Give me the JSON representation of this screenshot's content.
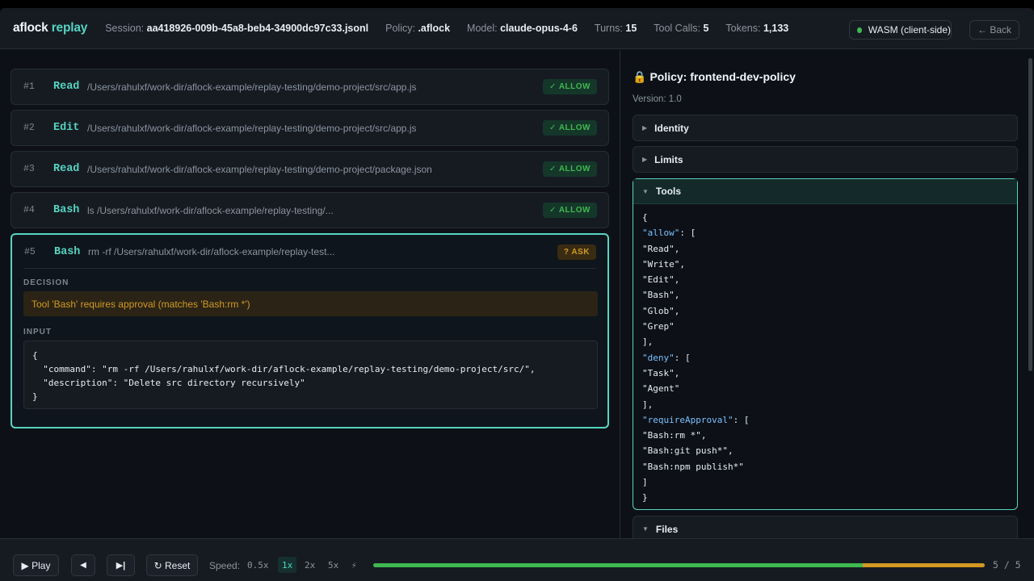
{
  "header": {
    "brand_main": "aflock",
    "brand_accent": "replay",
    "session_label": "Session:",
    "session_value": "aa418926-009b-45a8-beb4-34900dc97c33.jsonl",
    "policy_label": "Policy:",
    "policy_value": ".aflock",
    "model_label": "Model:",
    "model_value": "claude-opus-4-6",
    "turns_label": "Turns:",
    "turns_value": "15",
    "toolcalls_label": "Tool Calls:",
    "toolcalls_value": "5",
    "tokens_label": "Tokens:",
    "tokens_value": "1,133",
    "wasm_label": "WASM (client-side)",
    "back_label": "← Back"
  },
  "turns": [
    {
      "num": "#1",
      "tool": "Read",
      "path": "/Users/rahulxf/work-dir/aflock-example/replay-testing/demo-project/src/app.js",
      "badge": "✓ ALLOW"
    },
    {
      "num": "#2",
      "tool": "Edit",
      "path": "/Users/rahulxf/work-dir/aflock-example/replay-testing/demo-project/src/app.js",
      "badge": "✓ ALLOW"
    },
    {
      "num": "#3",
      "tool": "Read",
      "path": "/Users/rahulxf/work-dir/aflock-example/replay-testing/demo-project/package.json",
      "badge": "✓ ALLOW"
    },
    {
      "num": "#4",
      "tool": "Bash",
      "path": "ls /Users/rahulxf/work-dir/aflock-example/replay-testing/...",
      "badge": "✓ ALLOW"
    },
    {
      "num": "#5",
      "tool": "Bash",
      "path": "rm -rf /Users/rahulxf/work-dir/aflock-example/replay-test...",
      "badge": "? ASK"
    }
  ],
  "detail": {
    "decision_label": "DECISION",
    "decision_text": "Tool 'Bash' requires approval (matches 'Bash:rm *')",
    "input_label": "INPUT",
    "input_json": "{\n  \"command\": \"rm -rf /Users/rahulxf/work-dir/aflock-example/replay-testing/demo-project/src/\",\n  \"description\": \"Delete src directory recursively\"\n}"
  },
  "policy": {
    "lock_icon": "🔒",
    "title": "Policy: frontend-dev-policy",
    "version": "Version: 1.0",
    "sections": [
      {
        "label": "Identity",
        "caret": "▶"
      },
      {
        "label": "Limits",
        "caret": "▶"
      },
      {
        "label": "Tools",
        "caret": "▼"
      },
      {
        "label": "Files",
        "caret": "▼"
      }
    ],
    "tools_keys": {
      "allow": "\"allow\"",
      "deny": "\"deny\"",
      "requireApproval": "\"requireApproval\""
    },
    "tools_allow": [
      "Read",
      "Write",
      "Edit",
      "Bash",
      "Glob",
      "Grep"
    ],
    "tools_deny": [
      "Task",
      "Agent"
    ],
    "tools_require": [
      "Bash:rm *",
      "Bash:git push*",
      "Bash:npm publish*"
    ]
  },
  "footer": {
    "play_label": "▶ Play",
    "prev_label": "◀",
    "end_label": "▶|",
    "reset_label": "↻ Reset",
    "speed_label": "Speed:",
    "speeds": [
      "0.5x",
      "1x",
      "2x",
      "5x",
      "⚡"
    ],
    "active_speed": "1x",
    "counter": "5 / 5",
    "progress_allowed_fraction": 0.8,
    "progress_ask_fraction": 0.2,
    "colors": {
      "allowed": "#3fb950",
      "ask": "#d29922",
      "accent": "#56d4c1"
    }
  }
}
